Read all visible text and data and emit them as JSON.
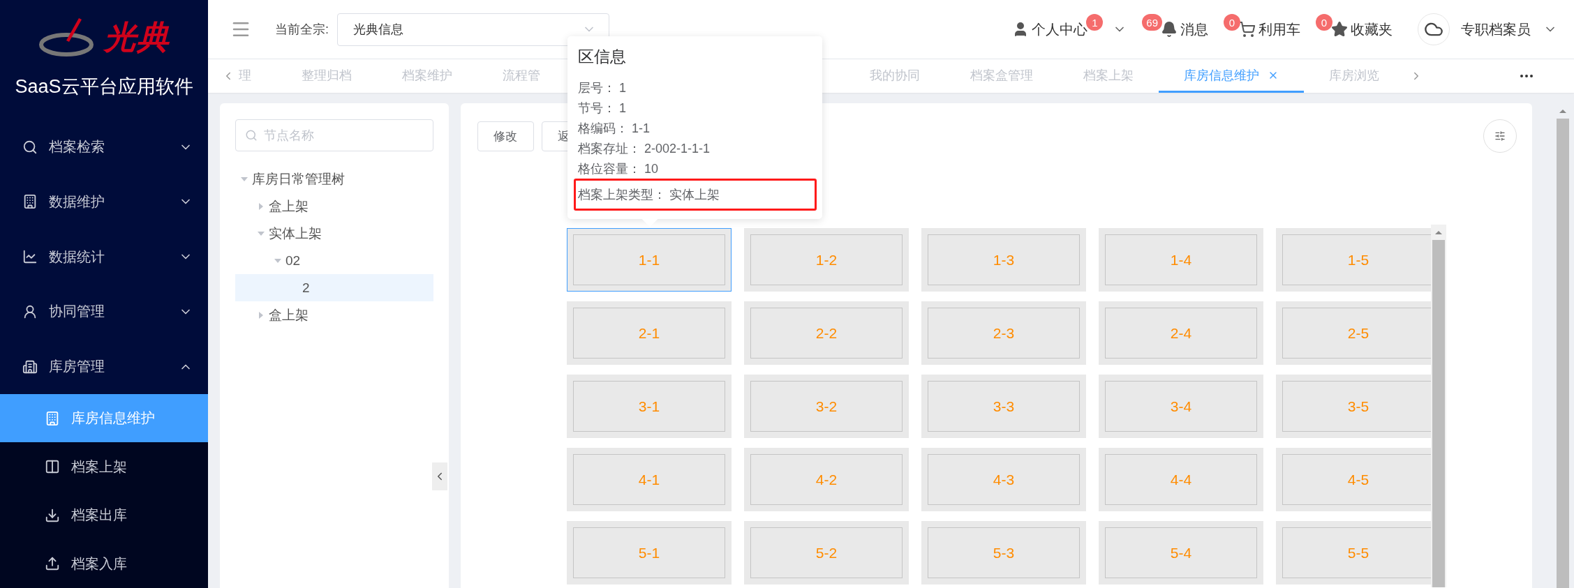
{
  "sidebar": {
    "brand": "光典",
    "title": "SaaS云平台应用软件",
    "menu": [
      {
        "label": "档案检索",
        "expanded": false
      },
      {
        "label": "数据维护",
        "expanded": false
      },
      {
        "label": "数据统计",
        "expanded": false
      },
      {
        "label": "协同管理",
        "expanded": false
      },
      {
        "label": "库房管理",
        "expanded": true,
        "children": [
          {
            "label": "库房信息维护",
            "selected": true
          },
          {
            "label": "档案上架",
            "selected": false
          },
          {
            "label": "档案出库",
            "selected": false
          },
          {
            "label": "档案入库",
            "selected": false
          }
        ]
      }
    ]
  },
  "header": {
    "fonds_label": "当前全宗:",
    "fonds_value": "光典信息",
    "actions": [
      {
        "label": "个人中心",
        "badge": "1",
        "dropdown": true
      },
      {
        "label": "消息",
        "badge": "69",
        "dropdown": false
      },
      {
        "label": "利用车",
        "badge": "0",
        "dropdown": false
      },
      {
        "label": "收藏夹",
        "badge": "0",
        "dropdown": false
      }
    ],
    "user": {
      "name": "专职档案员"
    }
  },
  "tabs": [
    {
      "label": "理",
      "selected": false
    },
    {
      "label": "整理归档",
      "selected": false
    },
    {
      "label": "档案维护",
      "selected": false
    },
    {
      "label": "流程管",
      "selected": false
    },
    {
      "label": "我的协同",
      "selected": false
    },
    {
      "label": "档案盒管理",
      "selected": false
    },
    {
      "label": "档案上架",
      "selected": false
    },
    {
      "label": "库房信息维护",
      "selected": true
    },
    {
      "label": "库房浏览",
      "selected": false
    }
  ],
  "tree": {
    "placeholder": "节点名称",
    "nodes": [
      {
        "label": "库房日常管理树",
        "expanded": true,
        "selected": false,
        "children": [
          {
            "label": "盒上架",
            "expanded": false,
            "selected": false
          },
          {
            "label": "实体上架",
            "expanded": true,
            "selected": false,
            "children": [
              {
                "label": "02",
                "expanded": true,
                "selected": false,
                "children": [
                  {
                    "label": "2",
                    "selected": true
                  }
                ]
              }
            ]
          },
          {
            "label": "盒上架",
            "expanded": false,
            "selected": false
          }
        ]
      }
    ]
  },
  "toolbar": {
    "buttons": [
      "修改",
      "返"
    ]
  },
  "tooltip": {
    "title": "区信息",
    "lines": [
      {
        "label": "层号：",
        "value": "1",
        "highlighted": false
      },
      {
        "label": "节号：",
        "value": "1",
        "highlighted": false
      },
      {
        "label": "格编码：",
        "value": "1-1",
        "highlighted": false
      },
      {
        "label": "档案存址：",
        "value": "2-002-1-1-1",
        "highlighted": false
      },
      {
        "label": "格位容量：",
        "value": "10",
        "highlighted": false
      },
      {
        "label": "档案上架类型：",
        "value": "实体上架",
        "highlighted": true
      }
    ]
  },
  "grid": [
    [
      {
        "label": "1-1",
        "selected": true
      },
      {
        "label": "1-2",
        "selected": false
      },
      {
        "label": "1-3",
        "selected": false
      },
      {
        "label": "1-4",
        "selected": false
      },
      {
        "label": "1-5",
        "selected": false
      }
    ],
    [
      {
        "label": "2-1",
        "selected": false
      },
      {
        "label": "2-2",
        "selected": false
      },
      {
        "label": "2-3",
        "selected": false
      },
      {
        "label": "2-4",
        "selected": false
      },
      {
        "label": "2-5",
        "selected": false
      }
    ],
    [
      {
        "label": "3-1",
        "selected": false
      },
      {
        "label": "3-2",
        "selected": false
      },
      {
        "label": "3-3",
        "selected": false
      },
      {
        "label": "3-4",
        "selected": false
      },
      {
        "label": "3-5",
        "selected": false
      }
    ],
    [
      {
        "label": "4-1",
        "selected": false
      },
      {
        "label": "4-2",
        "selected": false
      },
      {
        "label": "4-3",
        "selected": false
      },
      {
        "label": "4-4",
        "selected": false
      },
      {
        "label": "4-5",
        "selected": false
      }
    ],
    [
      {
        "label": "5-1",
        "selected": false
      },
      {
        "label": "5-2",
        "selected": false
      },
      {
        "label": "5-3",
        "selected": false
      },
      {
        "label": "5-4",
        "selected": false
      },
      {
        "label": "5-5",
        "selected": false
      }
    ]
  ]
}
